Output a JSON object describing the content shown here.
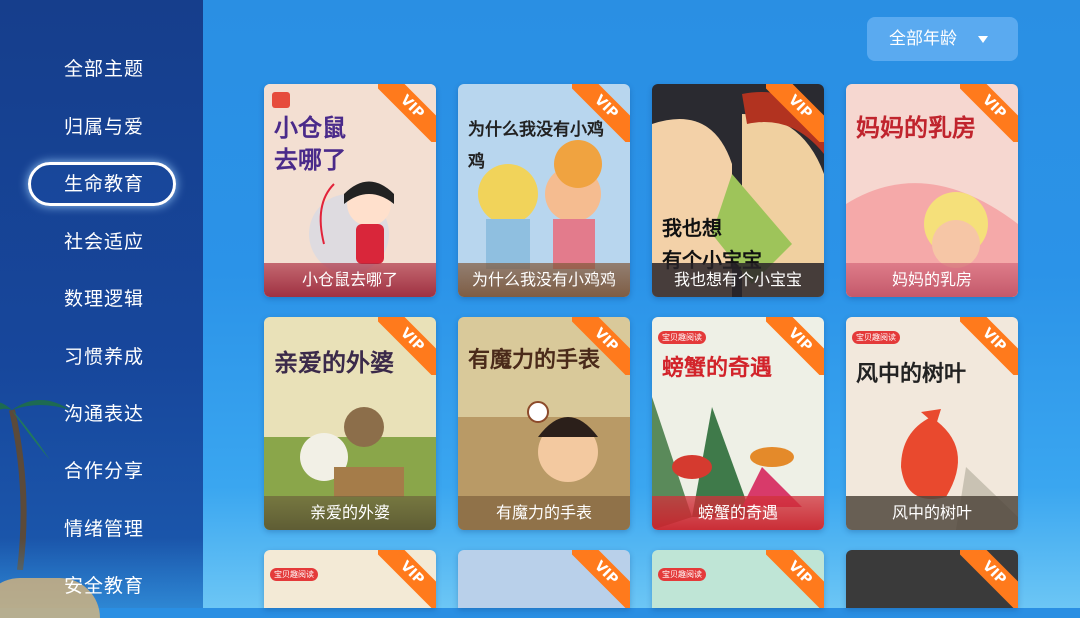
{
  "sidebar": {
    "items": [
      {
        "label": "全部主题"
      },
      {
        "label": "归属与爱"
      },
      {
        "label": "生命教育",
        "active": true
      },
      {
        "label": "社会适应"
      },
      {
        "label": "数理逻辑"
      },
      {
        "label": "习惯养成"
      },
      {
        "label": "沟通表达"
      },
      {
        "label": "合作分享"
      },
      {
        "label": "情绪管理"
      },
      {
        "label": "安全教育"
      }
    ]
  },
  "filter": {
    "age_label": "全部年龄",
    "icon": "triangle-down-icon"
  },
  "vip_label": "VIP",
  "publisher_tag": "宝贝趣阅读",
  "books": [
    {
      "caption": "小仓鼠去哪了",
      "cover_title": "小仓鼠\n去哪了"
    },
    {
      "caption": "为什么我没有小鸡鸡",
      "cover_title": "为什么我没有小鸡鸡"
    },
    {
      "caption": "我也想有个小宝宝",
      "cover_title": "我也想有个小宝宝"
    },
    {
      "caption": "妈妈的乳房",
      "cover_title": "妈妈的乳房"
    },
    {
      "caption": "亲爱的外婆",
      "cover_title": "亲爱的外婆"
    },
    {
      "caption": "有魔力的手表",
      "cover_title": "有魔力的手表"
    },
    {
      "caption": "螃蟹的奇遇",
      "cover_title": "螃蟹的奇遇"
    },
    {
      "caption": "风中的树叶",
      "cover_title": "风中的树叶"
    }
  ],
  "colors": {
    "sidebar": "#163e8c",
    "background": "#2a8fe3",
    "vip": "#ff7a1c",
    "select": "#5aaaf0"
  }
}
